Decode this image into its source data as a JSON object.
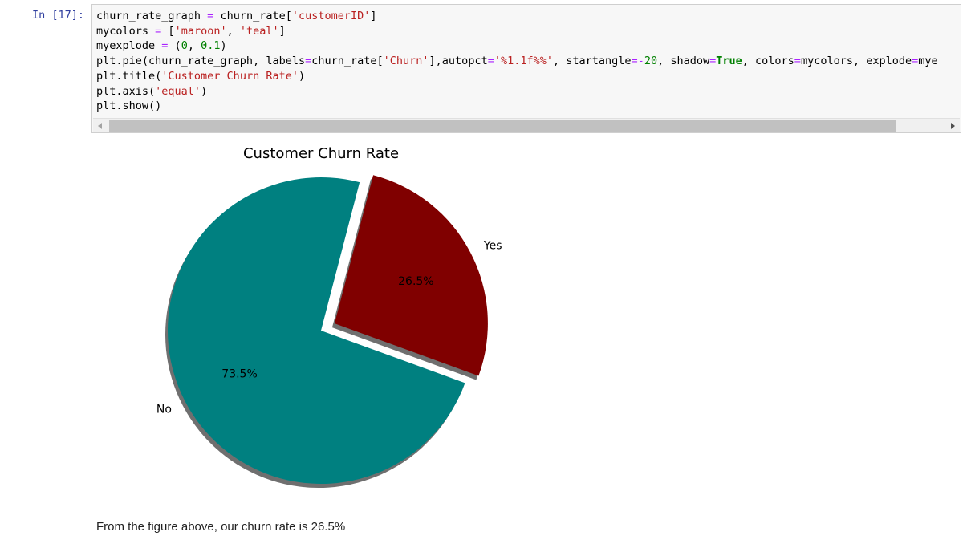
{
  "cell": {
    "prompt": "In [17]:",
    "code_lines": [
      [
        {
          "t": "churn_rate_graph "
        },
        {
          "t": "=",
          "c": "op"
        },
        {
          "t": " churn_rate["
        },
        {
          "t": "'customerID'",
          "c": "str"
        },
        {
          "t": "]"
        }
      ],
      [
        {
          "t": "mycolors "
        },
        {
          "t": "=",
          "c": "op"
        },
        {
          "t": " ["
        },
        {
          "t": "'maroon'",
          "c": "str"
        },
        {
          "t": ", "
        },
        {
          "t": "'teal'",
          "c": "str"
        },
        {
          "t": "]"
        }
      ],
      [
        {
          "t": "myexplode "
        },
        {
          "t": "=",
          "c": "op"
        },
        {
          "t": " ("
        },
        {
          "t": "0",
          "c": "num"
        },
        {
          "t": ", "
        },
        {
          "t": "0.1",
          "c": "num"
        },
        {
          "t": ")"
        }
      ],
      [
        {
          "t": "plt.pie(churn_rate_graph, labels"
        },
        {
          "t": "=",
          "c": "op"
        },
        {
          "t": "churn_rate["
        },
        {
          "t": "'Churn'",
          "c": "str"
        },
        {
          "t": "],autopct"
        },
        {
          "t": "=",
          "c": "op"
        },
        {
          "t": "'%1.1f%%'",
          "c": "str"
        },
        {
          "t": ", startangle"
        },
        {
          "t": "=-",
          "c": "op"
        },
        {
          "t": "20",
          "c": "num"
        },
        {
          "t": ", shadow"
        },
        {
          "t": "=",
          "c": "op"
        },
        {
          "t": "True",
          "c": "kw"
        },
        {
          "t": ", colors"
        },
        {
          "t": "=",
          "c": "op"
        },
        {
          "t": "mycolors, explode"
        },
        {
          "t": "=",
          "c": "op"
        },
        {
          "t": "mye"
        }
      ],
      [
        {
          "t": "plt.title("
        },
        {
          "t": "'Customer Churn Rate'",
          "c": "str"
        },
        {
          "t": ")"
        }
      ],
      [
        {
          "t": "plt.axis("
        },
        {
          "t": "'equal'",
          "c": "str"
        },
        {
          "t": ")"
        }
      ],
      [
        {
          "t": "plt.show()"
        }
      ]
    ]
  },
  "chart_data": {
    "type": "pie",
    "title": "Customer Churn Rate",
    "labels": [
      "Yes",
      "No"
    ],
    "values": [
      26.5,
      73.5
    ],
    "pct_labels": [
      "26.5%",
      "73.5%"
    ],
    "colors": [
      "#800000",
      "#008080"
    ],
    "explode": [
      0.1,
      0
    ],
    "startangle": -20,
    "shadow": true
  },
  "caption": "From the figure above, our churn rate is 26.5%"
}
